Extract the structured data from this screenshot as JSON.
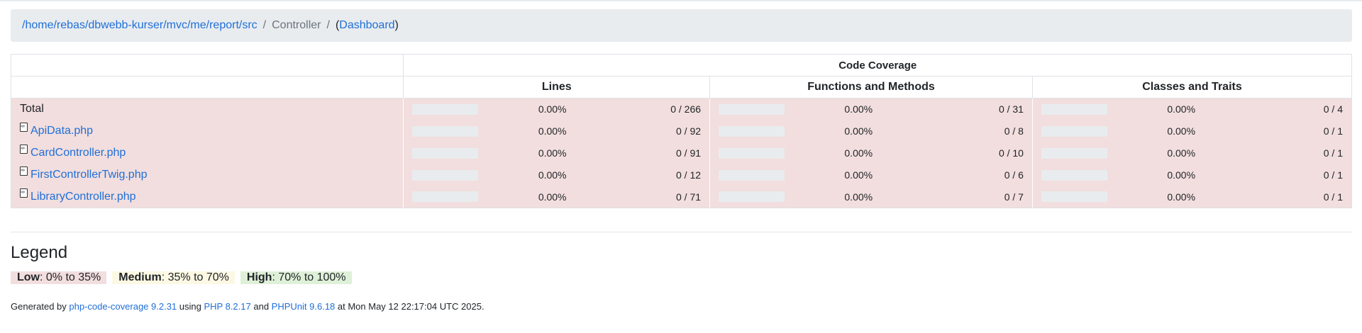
{
  "breadcrumb": {
    "path": "/home/rebas/dbwebb-kurser/mvc/me/report/src",
    "current": "Controller",
    "dashboard_open": "(",
    "dashboard_label": "Dashboard",
    "dashboard_close": ")"
  },
  "table": {
    "header_group": "Code Coverage",
    "columns": [
      "Lines",
      "Functions and Methods",
      "Classes and Traits"
    ],
    "rows": [
      {
        "name": "Total",
        "is_file": false,
        "lines_pct": "0.00%",
        "lines_ratio": "0 / 266",
        "funcs_pct": "0.00%",
        "funcs_ratio": "0 / 31",
        "classes_pct": "0.00%",
        "classes_ratio": "0 / 4"
      },
      {
        "name": "ApiData.php",
        "is_file": true,
        "lines_pct": "0.00%",
        "lines_ratio": "0 / 92",
        "funcs_pct": "0.00%",
        "funcs_ratio": "0 / 8",
        "classes_pct": "0.00%",
        "classes_ratio": "0 / 1"
      },
      {
        "name": "CardController.php",
        "is_file": true,
        "lines_pct": "0.00%",
        "lines_ratio": "0 / 91",
        "funcs_pct": "0.00%",
        "funcs_ratio": "0 / 10",
        "classes_pct": "0.00%",
        "classes_ratio": "0 / 1"
      },
      {
        "name": "FirstControllerTwig.php",
        "is_file": true,
        "lines_pct": "0.00%",
        "lines_ratio": "0 / 12",
        "funcs_pct": "0.00%",
        "funcs_ratio": "0 / 6",
        "classes_pct": "0.00%",
        "classes_ratio": "0 / 1"
      },
      {
        "name": "LibraryController.php",
        "is_file": true,
        "lines_pct": "0.00%",
        "lines_ratio": "0 / 71",
        "funcs_pct": "0.00%",
        "funcs_ratio": "0 / 7",
        "classes_pct": "0.00%",
        "classes_ratio": "0 / 1"
      }
    ]
  },
  "legend": {
    "title": "Legend",
    "low_label": "Low",
    "low_range": ": 0% to 35%",
    "medium_label": "Medium",
    "medium_range": ": 35% to 70%",
    "high_label": "High",
    "high_range": ": 70% to 100%"
  },
  "footer": {
    "prefix": "Generated by ",
    "tool": "php-code-coverage 9.2.31",
    "using": " using ",
    "php": "PHP 8.2.17",
    "and": " and ",
    "phpunit": "PHPUnit 9.6.18",
    "suffix": " at Mon May 12 22:17:04 UTC 2025."
  },
  "colors": {
    "low": "#f2dede",
    "medium": "#fcf8e3",
    "high": "#dff0d8",
    "link": "#1f6fd8"
  }
}
